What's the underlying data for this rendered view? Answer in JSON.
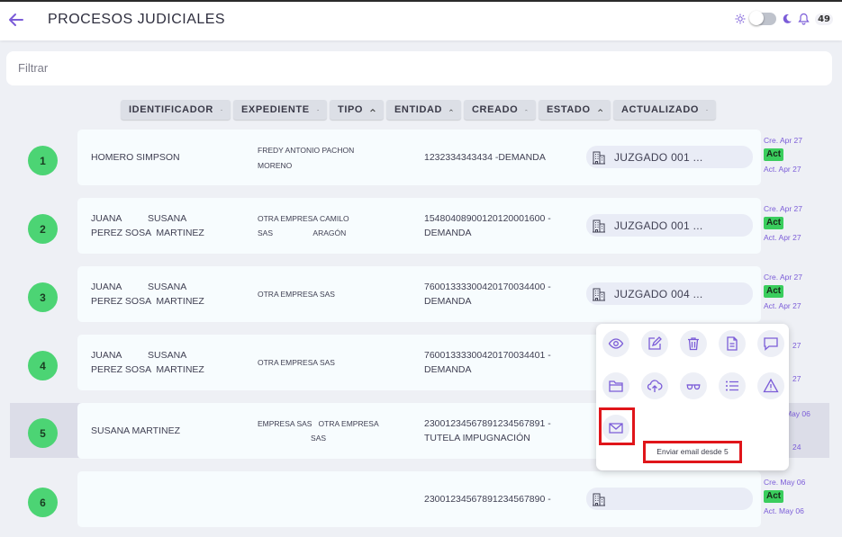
{
  "header": {
    "title": "PROCESOS JUDICIALES",
    "notification_count": "49"
  },
  "filter": {
    "placeholder": "Filtrar"
  },
  "columns": [
    {
      "label": "IDENTIFICADOR"
    },
    {
      "label": "EXPEDIENTE"
    },
    {
      "label": "TIPO"
    },
    {
      "label": "ENTIDAD"
    },
    {
      "label": "CREADO"
    },
    {
      "label": "ESTADO"
    },
    {
      "label": "ACTUALIZADO"
    }
  ],
  "rows": [
    {
      "num": "1",
      "col1a": "HOMERO SIMPSON",
      "col1b": "",
      "col2a": "FREDY ANTONIO PACHON",
      "col2b": "MORENO",
      "col3a": "1232334343434 -DEMANDA",
      "col3b": "",
      "entity": "JUZGADO 001 ...",
      "created": "Cre. Apr 27",
      "status": "Act",
      "updated": "Act. Apr 27"
    },
    {
      "num": "2",
      "col1a": "JUANA          SUSANA",
      "col1b": "PEREZ SOSA  MARTINEZ",
      "col2a": "OTRA EMPRESA CAMILO",
      "col2b": "SAS                   ARAGÓN",
      "col3a": "15480408900120120001600 -",
      "col3b": "DEMANDA",
      "entity": "JUZGADO 001 ...",
      "created": "Cre. Apr 27",
      "status": "Act",
      "updated": "Act. Apr 27"
    },
    {
      "num": "3",
      "col1a": "JUANA          SUSANA",
      "col1b": "PEREZ SOSA  MARTINEZ",
      "col2a": "",
      "col2b": "OTRA EMPRESA SAS",
      "col3a": "76001333300420170034400 -",
      "col3b": "DEMANDA",
      "entity": "JUZGADO 004 ...",
      "created": "Cre. Apr 27",
      "status": "Act",
      "updated": "Act. Apr 27"
    },
    {
      "num": "4",
      "col1a": "JUANA          SUSANA",
      "col1b": "PEREZ SOSA  MARTINEZ",
      "col2a": "",
      "col2b": "OTRA EMPRESA SAS",
      "col3a": "76001333300420170034401 -",
      "col3b": "DEMANDA",
      "entity": "",
      "created": "27",
      "status": "",
      "updated": "27"
    },
    {
      "num": "5",
      "col1a": "",
      "col1b": "SUSANA MARTINEZ",
      "col2a": "EMPRESA SAS   OTRA EMPRESA",
      "col2b": "                         SAS",
      "col3a": "23001234567891234567891 -",
      "col3b": "TUTELA IMPUGNACIÓN",
      "entity": "",
      "created": "May 06",
      "status": "",
      "updated": "24"
    },
    {
      "num": "6",
      "col1a": "",
      "col1b": "",
      "col2a": "",
      "col2b": "",
      "col3a": "23001234567891234567890 -",
      "col3b": "",
      "entity": "",
      "created": "Cre. May 06",
      "status": "Act",
      "updated": "Act. May 06"
    }
  ],
  "popup": {
    "tooltip": "Enviar email desde 5",
    "icons": [
      "eye-icon",
      "edit-icon",
      "trash-icon",
      "document-icon",
      "comment-icon",
      "folder-icon",
      "cloud-upload-icon",
      "glasses-icon",
      "list-icon",
      "warning-icon",
      "mail-icon"
    ]
  },
  "colors": {
    "accent": "#7b5cd8",
    "status_green": "#3acd5d",
    "number_green": "#4cd474",
    "highlight": "#e0151a"
  }
}
